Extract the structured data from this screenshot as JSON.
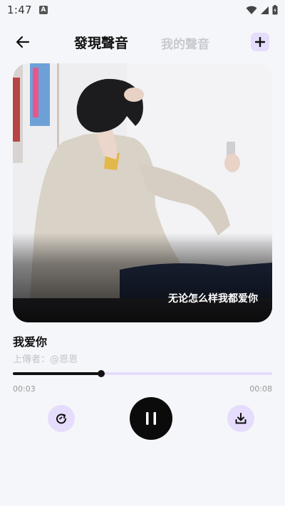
{
  "status_bar": {
    "time": "1:47",
    "notification_icon": "a-notification-icon",
    "icons": [
      "wifi-icon",
      "signal-icon",
      "battery-icon"
    ]
  },
  "header": {
    "back_icon": "arrow-left-icon",
    "tabs": [
      {
        "label": "發現聲音",
        "active": true
      },
      {
        "label": "我的聲音",
        "active": false
      }
    ],
    "add_icon": "plus-icon"
  },
  "cover": {
    "caption": "无论怎么样我都爱你"
  },
  "track": {
    "title": "我爱你",
    "uploader_label": "上傳者：",
    "uploader_name": "@恩恩"
  },
  "player": {
    "current_time": "00:03",
    "total_time": "00:08",
    "progress": 0.34,
    "state": "playing",
    "controls": [
      "loop-icon",
      "pause-icon",
      "download-icon"
    ]
  },
  "colors": {
    "accent_light": "#e6dcfb",
    "background": "#f5f6fa",
    "primary": "#0b0b0b"
  }
}
